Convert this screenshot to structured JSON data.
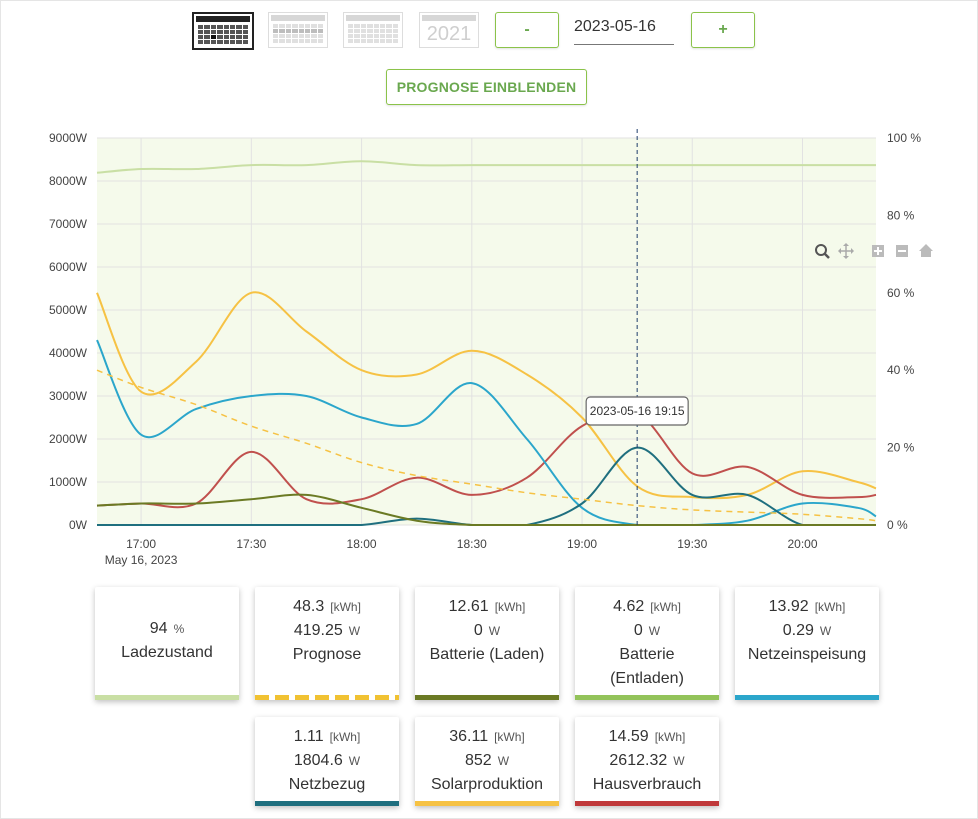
{
  "toolbar": {
    "views": [
      {
        "name": "day",
        "active": true
      },
      {
        "name": "week",
        "active": false
      },
      {
        "name": "month",
        "active": false
      },
      {
        "name": "year",
        "active": false,
        "label": "2021"
      }
    ],
    "minus_label": "-",
    "plus_label": "+",
    "date_value": "2023-05-16"
  },
  "prognose_button": "PROGNOSE EINBLENDEN",
  "chart_data": {
    "type": "line",
    "title": "",
    "x_ticks": [
      "17:00",
      "17:30",
      "18:00",
      "18:30",
      "19:00",
      "19:30",
      "20:00"
    ],
    "x_date_label": "May 16, 2023",
    "y_left_ticks": [
      "0W",
      "1000W",
      "2000W",
      "3000W",
      "4000W",
      "5000W",
      "6000W",
      "7000W",
      "8000W",
      "9000W"
    ],
    "y_left_range": [
      0,
      9000
    ],
    "y_right_ticks": [
      "0 %",
      "20 %",
      "40 %",
      "60 %",
      "80 %",
      "100 %"
    ],
    "y_right_range": [
      0,
      100
    ],
    "x_range": [
      "16:48",
      "20:20"
    ],
    "grid": true,
    "tooltip": "2023-05-16 19:15",
    "crosshair_time": "19:15",
    "toolbar_icons": [
      "zoom-icon",
      "pan-icon",
      "zoom-in-icon",
      "zoom-out-icon",
      "home-icon"
    ],
    "series": [
      {
        "name": "Ladezustand",
        "axis": "right",
        "color": "#c9dfa4",
        "x": [
          "16:48",
          "17:00",
          "17:15",
          "17:30",
          "17:45",
          "18:00",
          "18:15",
          "18:30",
          "18:45",
          "19:00",
          "19:15",
          "19:30",
          "19:45",
          "20:00",
          "20:15",
          "20:20"
        ],
        "y": [
          91,
          92,
          92,
          93,
          93,
          94,
          93,
          93,
          93,
          93,
          93,
          93,
          93,
          93,
          93,
          93
        ]
      },
      {
        "name": "Solarproduktion",
        "axis": "left",
        "color": "#f6c244",
        "x": [
          "16:48",
          "17:00",
          "17:15",
          "17:30",
          "17:45",
          "18:00",
          "18:15",
          "18:30",
          "18:45",
          "19:00",
          "19:15",
          "19:30",
          "19:45",
          "20:00",
          "20:15",
          "20:20"
        ],
        "y": [
          5400,
          3100,
          3800,
          5400,
          4500,
          3600,
          3500,
          4050,
          3500,
          2500,
          900,
          650,
          700,
          1250,
          1000,
          850
        ]
      },
      {
        "name": "Hausverbrauch",
        "axis": "left",
        "color": "#c0504d",
        "x": [
          "16:48",
          "17:00",
          "17:15",
          "17:30",
          "17:45",
          "18:00",
          "18:15",
          "18:30",
          "18:45",
          "19:00",
          "19:15",
          "19:30",
          "19:45",
          "20:00",
          "20:15",
          "20:20"
        ],
        "y": [
          450,
          500,
          500,
          1700,
          600,
          600,
          1100,
          700,
          1100,
          2300,
          2600,
          1200,
          1350,
          700,
          650,
          700
        ]
      },
      {
        "name": "Netzeinspeisung",
        "axis": "left",
        "color": "#2ba6cb",
        "x": [
          "16:48",
          "17:00",
          "17:15",
          "17:30",
          "17:45",
          "18:00",
          "18:15",
          "18:30",
          "18:45",
          "19:00",
          "19:15",
          "19:30",
          "19:45",
          "20:00",
          "20:15",
          "20:20"
        ],
        "y": [
          4300,
          2100,
          2700,
          3000,
          3000,
          2500,
          2350,
          3300,
          2000,
          400,
          0,
          0,
          100,
          500,
          400,
          200
        ]
      },
      {
        "name": "Netzbezug",
        "axis": "left",
        "color": "#1f6f7f",
        "x": [
          "16:48",
          "17:00",
          "17:15",
          "17:30",
          "17:45",
          "18:00",
          "18:15",
          "18:30",
          "18:45",
          "19:00",
          "19:15",
          "19:30",
          "19:45",
          "20:00",
          "20:15",
          "20:20"
        ],
        "y": [
          0,
          0,
          0,
          0,
          0,
          0,
          150,
          0,
          0,
          500,
          1800,
          700,
          700,
          0,
          0,
          0
        ]
      },
      {
        "name": "Batterie (Laden)",
        "axis": "left",
        "color": "#6b7a24",
        "x": [
          "16:48",
          "17:00",
          "17:15",
          "17:30",
          "17:45",
          "18:00",
          "18:15",
          "18:30",
          "18:45",
          "19:00",
          "19:15",
          "19:30",
          "19:45",
          "20:00",
          "20:15",
          "20:20"
        ],
        "y": [
          450,
          500,
          500,
          600,
          700,
          400,
          100,
          0,
          0,
          0,
          0,
          0,
          0,
          0,
          0,
          0
        ]
      },
      {
        "name": "Prognose",
        "axis": "left",
        "color": "#f6c244",
        "dashed": true,
        "x": [
          "16:48",
          "17:00",
          "17:15",
          "17:30",
          "17:45",
          "18:00",
          "18:15",
          "18:30",
          "18:45",
          "19:00",
          "19:15",
          "19:30",
          "19:45",
          "20:00",
          "20:15",
          "20:20"
        ],
        "y": [
          3600,
          3200,
          2800,
          2300,
          1900,
          1450,
          1150,
          950,
          750,
          600,
          450,
          350,
          300,
          250,
          150,
          100
        ]
      }
    ]
  },
  "cards": [
    {
      "id": "ladezustand",
      "line1_value": "94",
      "line1_unit": "%",
      "line2_value": "",
      "line2_unit": "",
      "label": "Ladezustand",
      "color": "#c9dfa4"
    },
    {
      "id": "prognose",
      "line1_value": "48.3",
      "line1_unit": "[kWh]",
      "line2_value": "419.25",
      "line2_unit": "W",
      "label": "Prognose",
      "color": "#f1c232"
    },
    {
      "id": "batterie-laden",
      "line1_value": "12.61",
      "line1_unit": "[kWh]",
      "line2_value": "0",
      "line2_unit": "W",
      "label": "Batterie (Laden)",
      "color": "#6b7a24"
    },
    {
      "id": "batterie-entladen",
      "line1_value": "4.62",
      "line1_unit": "[kWh]",
      "line2_value": "0",
      "line2_unit": "W",
      "label": "Batterie (Entladen)",
      "color": "#93c35a"
    },
    {
      "id": "netzeinspeisung",
      "line1_value": "13.92",
      "line1_unit": "[kWh]",
      "line2_value": "0.29",
      "line2_unit": "W",
      "label": "Netzeinspeisung",
      "color": "#2ba6cb"
    },
    {
      "id": "netzbezug",
      "line1_value": "1.11",
      "line1_unit": "[kWh]",
      "line2_value": "1804.6",
      "line2_unit": "W",
      "label": "Netzbezug",
      "color": "#1f6f7f"
    },
    {
      "id": "solarproduktion",
      "line1_value": "36.11",
      "line1_unit": "[kWh]",
      "line2_value": "852",
      "line2_unit": "W",
      "label": "Solarproduktion",
      "color": "#f6c244"
    },
    {
      "id": "hausverbrauch",
      "line1_value": "14.59",
      "line1_unit": "[kWh]",
      "line2_value": "2612.32",
      "line2_unit": "W",
      "label": "Hausverbrauch",
      "color": "#c0393b"
    }
  ]
}
